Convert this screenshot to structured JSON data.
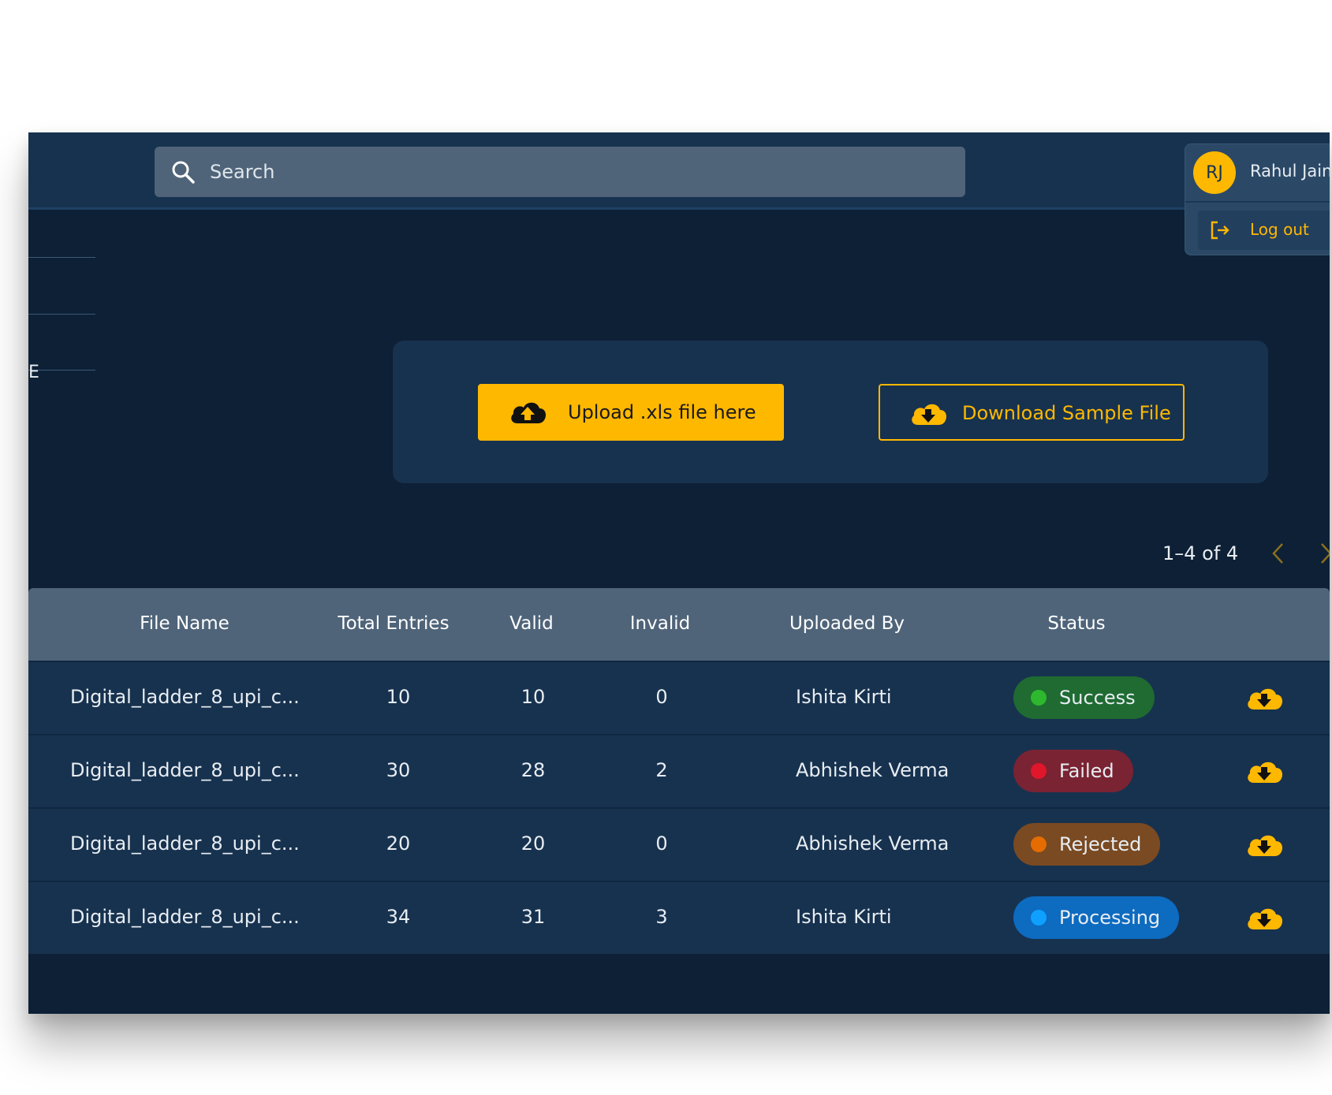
{
  "header": {
    "search_placeholder": "Search"
  },
  "user": {
    "initials": "RJ",
    "name": "Rahul Jain",
    "logout_label": "Log out"
  },
  "sidebar": {
    "fragment_text": "E"
  },
  "upload": {
    "upload_label": "Upload .xls file here",
    "download_label": "Download Sample File"
  },
  "pagination": {
    "text": "1–4 of 4"
  },
  "table": {
    "columns": [
      "File Name",
      "Total Entries",
      "Valid",
      "Invalid",
      "Uploaded By",
      "Status"
    ],
    "rows": [
      {
        "file_name": "Digital_ladder_8_upi_c...",
        "total": "10",
        "valid": "10",
        "invalid": "0",
        "uploaded_by": "Ishita Kirti",
        "status": "Success"
      },
      {
        "file_name": "Digital_ladder_8_upi_c...",
        "total": "30",
        "valid": "28",
        "invalid": "2",
        "uploaded_by": "Abhishek Verma",
        "status": "Failed"
      },
      {
        "file_name": "Digital_ladder_8_upi_c...",
        "total": "20",
        "valid": "20",
        "invalid": "0",
        "uploaded_by": "Abhishek Verma",
        "status": "Rejected"
      },
      {
        "file_name": "Digital_ladder_8_upi_c...",
        "total": "34",
        "valid": "31",
        "invalid": "3",
        "uploaded_by": "Ishita Kirti",
        "status": "Processing"
      }
    ]
  },
  "status_colors": {
    "Success": {
      "bg": "#1f6b32",
      "dot": "#2eb82e"
    },
    "Failed": {
      "bg": "#7a2333",
      "dot": "#e0162b"
    },
    "Rejected": {
      "bg": "#7a4a22",
      "dot": "#e56c00"
    },
    "Processing": {
      "bg": "#0d6bc0",
      "dot": "#0fa0ff"
    }
  },
  "colors": {
    "accent": "#ffb800",
    "background": "#0d2035",
    "panel": "#17324f",
    "header": "#4f6479"
  }
}
